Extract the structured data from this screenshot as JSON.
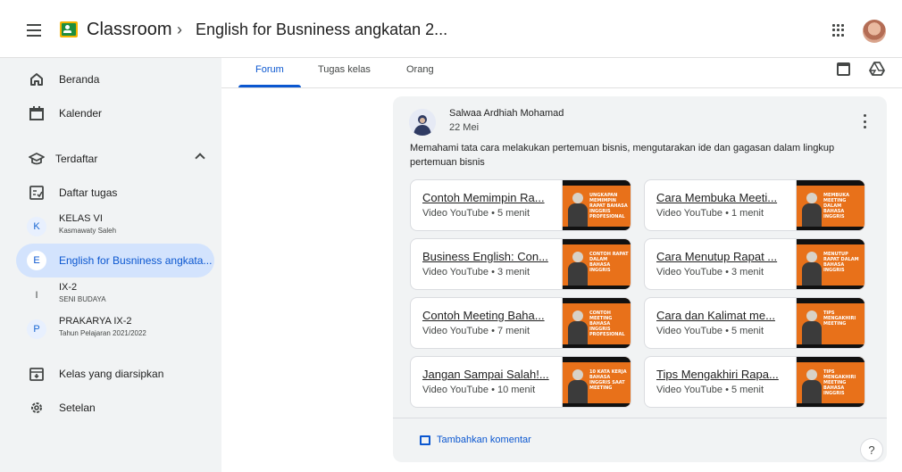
{
  "header": {
    "app_title": "Classroom",
    "separator": "›",
    "course_title": "English for Busniness angkatan 2..."
  },
  "sidebar": {
    "items": [
      {
        "label": "Beranda",
        "icon": "home-icon"
      },
      {
        "label": "Kalender",
        "icon": "calendar-icon"
      }
    ],
    "enrolled_label": "Terdaftar",
    "todo_label": "Daftar tugas",
    "classes": [
      {
        "initial": "K",
        "name": "KELAS VI",
        "sub": "Kasmawaty Saleh",
        "color": "#e8f0fe",
        "text_color": "#1967d2"
      },
      {
        "initial": "E",
        "name": "English for Busniness angkata...",
        "sub": "",
        "color": "#ffffff",
        "text_color": "#0b57d0"
      },
      {
        "initial": "I",
        "name": "IX-2",
        "sub": "SENI BUDAYA",
        "color": "#f1f3f4",
        "text_color": "#444746"
      },
      {
        "initial": "P",
        "name": "PRAKARYA IX-2",
        "sub": "Tahun Pelajaran 2021/2022",
        "color": "#e8f0fe",
        "text_color": "#1967d2"
      }
    ],
    "archived_label": "Kelas yang diarsipkan",
    "settings_label": "Setelan"
  },
  "tabs": [
    "Forum",
    "Tugas kelas",
    "Orang"
  ],
  "post": {
    "author": "Salwaa Ardhiah Mohamad",
    "date": "22 Mei",
    "description": "Memahami tata cara melakukan pertemuan bisnis, mengutarakan ide dan gagasan dalam lingkup pertemuan bisnis",
    "attachments": [
      {
        "title": "Contoh Memimpin Ra...",
        "meta": "Video YouTube • 5 menit",
        "caption": "Ungkapan memimpin rapat bahasa Inggris profesional"
      },
      {
        "title": "Cara Membuka Meeti...",
        "meta": "Video YouTube • 1 menit",
        "caption": "Membuka meeting dalam bahasa Inggris"
      },
      {
        "title": "Business English: Con...",
        "meta": "Video YouTube • 3 menit",
        "caption": "Contoh rapat dalam bahasa Inggris"
      },
      {
        "title": "Cara Menutup Rapat ...",
        "meta": "Video YouTube • 3 menit",
        "caption": "Menutup rapat dalam bahasa Inggris"
      },
      {
        "title": "Contoh Meeting Baha...",
        "meta": "Video YouTube • 7 menit",
        "caption": "Contoh meeting bahasa Inggris profesional"
      },
      {
        "title": "Cara dan Kalimat me...",
        "meta": "Video YouTube • 5 menit",
        "caption": "Tips mengakhiri meeting"
      },
      {
        "title": "Jangan Sampai Salah!...",
        "meta": "Video YouTube • 10 menit",
        "caption": "10 kata kerja bahasa Inggris saat meeting"
      },
      {
        "title": "Tips Mengakhiri Rapa...",
        "meta": "Video YouTube • 5 menit",
        "caption": "Tips mengakhiri meeting bahasa Inggris"
      }
    ],
    "add_comment_label": "Tambahkan komentar"
  },
  "help_label": "?"
}
